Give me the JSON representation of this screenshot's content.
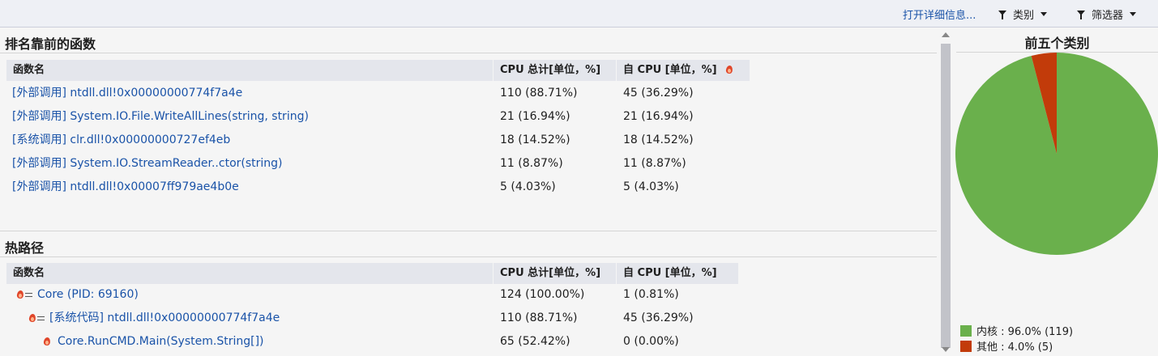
{
  "toolbar": {
    "details_link": "打开详细信息...",
    "category_label": "类别",
    "filter_label": "筛选器"
  },
  "top_functions": {
    "title": "排名靠前的函数",
    "headers": [
      "函数名",
      "CPU 总计[单位，%]",
      "自 CPU [单位，%]"
    ],
    "rows": [
      [
        "[外部调用] ntdll.dll!0x00000000774f7a4e",
        "110 (88.71%)",
        "45 (36.29%)"
      ],
      [
        "[外部调用] System.IO.File.WriteAllLines(string, string)",
        "21 (16.94%)",
        "21 (16.94%)"
      ],
      [
        "[系统调用] clr.dll!0x00000000727ef4eb",
        "18 (14.52%)",
        "18 (14.52%)"
      ],
      [
        "[外部调用] System.IO.StreamReader..ctor(string)",
        "11 (8.87%)",
        "11 (8.87%)"
      ],
      [
        "[外部调用] ntdll.dll!0x00007ff979ae4b0e",
        "5 (4.03%)",
        "5 (4.03%)"
      ]
    ]
  },
  "hot_path": {
    "title": "热路径",
    "headers": [
      "函数名",
      "CPU 总计[单位，%]",
      "自 CPU [单位，%]"
    ],
    "rows": [
      [
        "Core (PID: 69160)",
        "124 (100.00%)",
        "1 (0.81%)"
      ],
      [
        "[系统代码] ntdll.dll!0x00000000774f7a4e",
        "110 (88.71%)",
        "45 (36.29%)"
      ],
      [
        "Core.RunCMD.Main(System.String[])",
        "65 (52.42%)",
        "0 (0.00%)"
      ]
    ]
  },
  "categories": {
    "title": "前五个类别",
    "legend": [
      {
        "label": "内核 : 96.0% (119)",
        "color": "#6ab04c"
      },
      {
        "label": "其他 : 4.0% (5)",
        "color": "#c23b0a"
      }
    ]
  },
  "chart_data": {
    "type": "pie",
    "title": "前五个类别",
    "series": [
      {
        "name": "内核",
        "value": 119,
        "percent": 96.0,
        "color": "#6ab04c"
      },
      {
        "name": "其他",
        "value": 5,
        "percent": 4.0,
        "color": "#c23b0a"
      }
    ]
  }
}
